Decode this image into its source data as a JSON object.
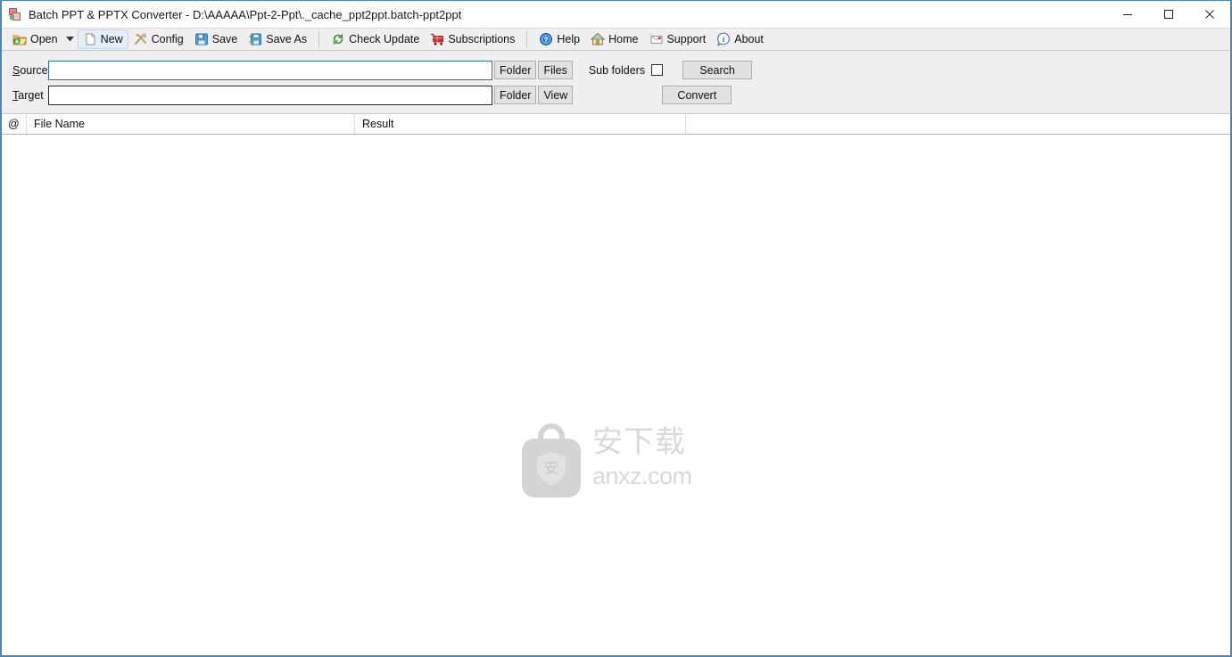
{
  "window": {
    "title": "Batch PPT & PPTX Converter - D:\\AAAAA\\Ppt-2-Ppt\\._cache_ppt2ppt.batch-ppt2ppt",
    "app_icon": "app-icon",
    "controls": {
      "minimize": "minimize-icon",
      "maximize": "maximize-icon",
      "close": "close-icon"
    },
    "border_color": "#4a86b8"
  },
  "toolbar": {
    "background": "#f0eef0",
    "items": [
      {
        "label": "Open",
        "icon": "open-folder-icon",
        "has_dropdown": true,
        "hover": false
      },
      {
        "label": "New",
        "icon": "new-document-icon",
        "has_dropdown": false,
        "hover": true
      },
      {
        "label": "Config",
        "icon": "tools-icon",
        "has_dropdown": false,
        "hover": false
      },
      {
        "label": "Save",
        "icon": "floppy-disk-icon",
        "has_dropdown": false,
        "hover": false
      },
      {
        "label": "Save As",
        "icon": "floppy-disk-as-icon",
        "has_dropdown": false,
        "hover": false
      },
      {
        "label": "Check Update",
        "icon": "refresh-arrows-icon",
        "has_dropdown": false,
        "hover": false
      },
      {
        "label": "Subscriptions",
        "icon": "shopping-cart-icon",
        "has_dropdown": false,
        "hover": false
      },
      {
        "label": "Help",
        "icon": "help-circle-icon",
        "has_dropdown": false,
        "hover": false
      },
      {
        "label": "Home",
        "icon": "house-icon",
        "has_dropdown": false,
        "hover": false
      },
      {
        "label": "Support",
        "icon": "envelope-icon",
        "has_dropdown": false,
        "hover": false
      },
      {
        "label": "About",
        "icon": "info-circle-icon",
        "has_dropdown": false,
        "hover": false
      }
    ]
  },
  "form": {
    "source": {
      "label": "Source",
      "accel": "S",
      "value": "",
      "placeholder": "",
      "focused": true,
      "folder_button": "Folder",
      "files_button": "Files",
      "subfolders_label": "Sub folders",
      "subfolders_checked": false,
      "action_button": "Search"
    },
    "target": {
      "label": "Target",
      "accel": "T",
      "value": "",
      "placeholder": "",
      "focused": false,
      "folder_button": "Folder",
      "view_button": "View",
      "action_button": "Convert"
    }
  },
  "list": {
    "columns": [
      {
        "key": "at",
        "label": "@"
      },
      {
        "key": "name",
        "label": "File Name"
      },
      {
        "key": "result",
        "label": "Result"
      }
    ],
    "rows": []
  },
  "watermark": {
    "cn_text": "安下载",
    "domain": "anxz.com",
    "bag_glyph": "安",
    "color": "#d9d9d9"
  }
}
